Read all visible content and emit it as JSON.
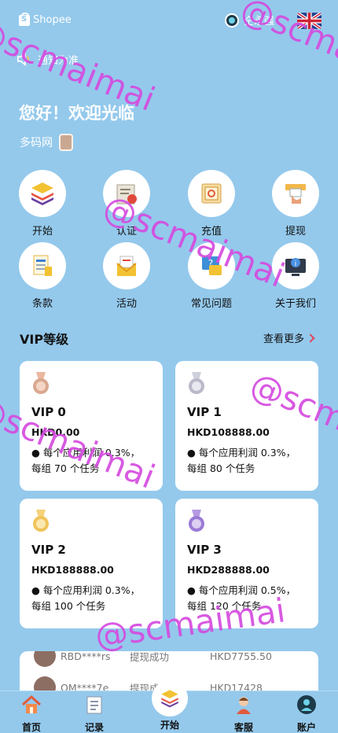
{
  "header": {
    "brand": "Shopee",
    "user_name": "仝永强",
    "language": "English"
  },
  "notice": {
    "text": "通知为准"
  },
  "greeting": "您好！欢迎光临",
  "site_name": "多码网",
  "menu": [
    {
      "label": "开始",
      "icon": "stack-icon"
    },
    {
      "label": "认证",
      "icon": "certificate-icon"
    },
    {
      "label": "充值",
      "icon": "safe-icon"
    },
    {
      "label": "提现",
      "icon": "withdraw-icon"
    },
    {
      "label": "条款",
      "icon": "document-icon"
    },
    {
      "label": "活动",
      "icon": "event-icon"
    },
    {
      "label": "常见问题",
      "icon": "faq-icon"
    },
    {
      "label": "关于我们",
      "icon": "info-icon"
    }
  ],
  "vip": {
    "title": "VIP等级",
    "more": "查看更多",
    "levels": [
      {
        "name": "VIP 0",
        "price": "HKD0.00",
        "desc1": "● 每个应用利润 0.3%，",
        "desc2": "每组 70 个任务",
        "medal_color": "#d9a88f"
      },
      {
        "name": "VIP 1",
        "price": "HKD108888.00",
        "desc1": "● 每个应用利润 0.3%，",
        "desc2": "每组 80 个任务",
        "medal_color": "#b9b9c9"
      },
      {
        "name": "VIP 2",
        "price": "HKD188888.00",
        "desc1": "● 每个应用利润 0.3%，",
        "desc2": "每组 100 个任务",
        "medal_color": "#f0c35a"
      },
      {
        "name": "VIP 3",
        "price": "HKD288888.00",
        "desc1": "● 每个应用利润 0.5%，",
        "desc2": "每组 120 个任务",
        "medal_color": "#9b7ad6"
      }
    ]
  },
  "ticker": [
    {
      "user": "RBD****rs",
      "action": "提现成功",
      "amount": "HKD7755.50"
    },
    {
      "user": "OM****7e",
      "action": "提现成功",
      "amount": "HKD17428"
    }
  ],
  "nav": [
    {
      "label": "首页",
      "icon": "home-icon"
    },
    {
      "label": "记录",
      "icon": "record-icon"
    },
    {
      "label": "开始",
      "icon": "stack-icon"
    },
    {
      "label": "客服",
      "icon": "support-icon"
    },
    {
      "label": "账户",
      "icon": "account-icon"
    }
  ],
  "watermark": "@scmaimai",
  "colors": {
    "background": "#94c9ec",
    "accent": "#e2455c",
    "watermark": "#d54ce0"
  }
}
